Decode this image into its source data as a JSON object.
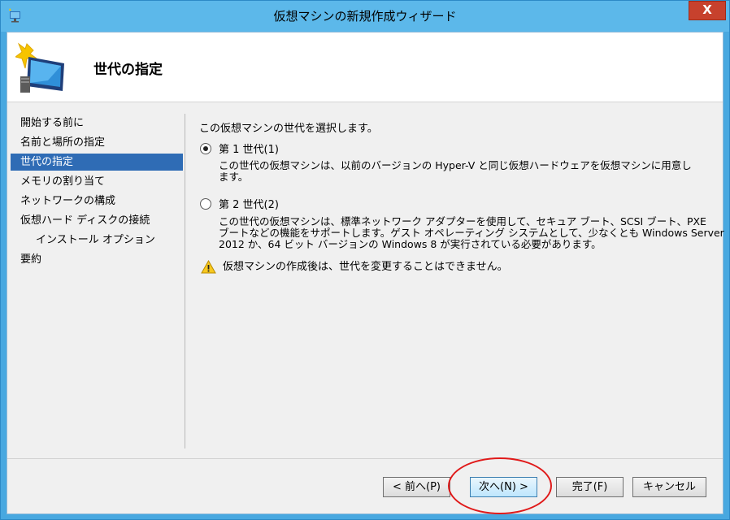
{
  "window": {
    "title": "仮想マシンの新規作成ウィザード",
    "close_label": "X"
  },
  "header": {
    "title": "世代の指定"
  },
  "nav": {
    "items": [
      {
        "label": "開始する前に"
      },
      {
        "label": "名前と場所の指定"
      },
      {
        "label": "世代の指定"
      },
      {
        "label": "メモリの割り当て"
      },
      {
        "label": "ネットワークの構成"
      },
      {
        "label": "仮想ハード ディスクの接続"
      },
      {
        "label": "インストール オプション"
      },
      {
        "label": "要約"
      }
    ],
    "selected_index": 2
  },
  "content": {
    "intro": "この仮想マシンの世代を選択します。",
    "gen1": {
      "label": "第 1 世代(1)",
      "desc_line1": "この世代の仮想マシンは、以前のバージョンの Hyper-V と同じ仮想ハードウェアを仮想マシンに用意し",
      "desc_line2": "ます。",
      "selected": true
    },
    "gen2": {
      "label": "第 2 世代(2)",
      "desc_line1": "この世代の仮想マシンは、標準ネットワーク アダプターを使用して、セキュア ブート、SCSI ブート、PXE",
      "desc_line2": "ブートなどの機能をサポートします。ゲスト オペレーティング システムとして、少なくとも Windows Server",
      "desc_line3": "2012 か、64 ビット バージョンの Windows 8 が実行されている必要があります。",
      "selected": false
    },
    "warning": "仮想マシンの作成後は、世代を変更することはできません。"
  },
  "buttons": {
    "prev": "< 前へ(P)",
    "next": "次へ(N) >",
    "finish": "完了(F)",
    "cancel": "キャンセル"
  },
  "colors": {
    "titlebar": "#5cb8ea",
    "close": "#c7412d",
    "selection": "#2f6cb5",
    "annotation": "#e01a1a"
  }
}
